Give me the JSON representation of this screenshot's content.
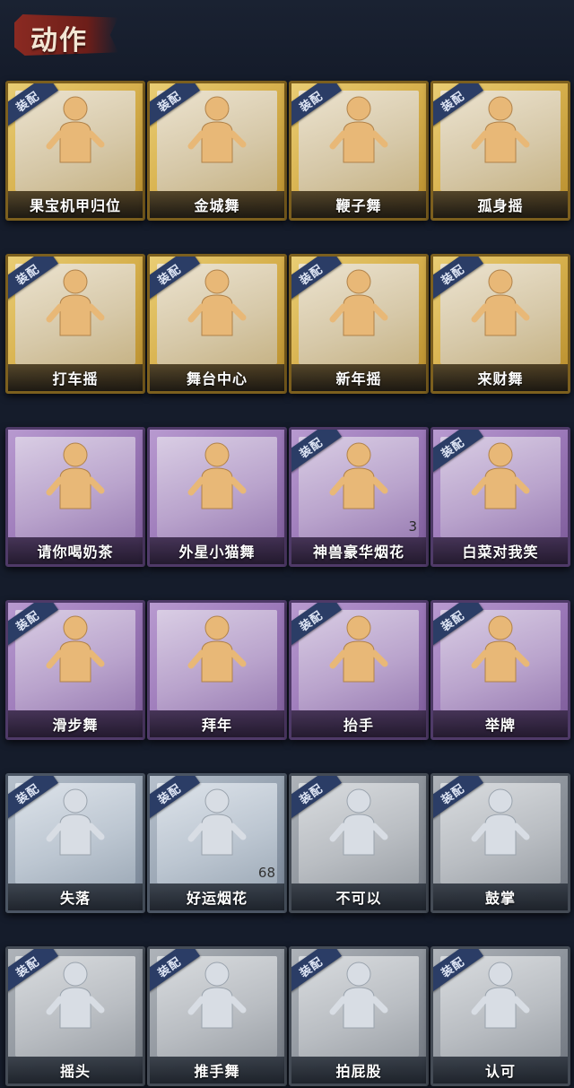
{
  "header": {
    "title": "动作"
  },
  "equip_label": "装配",
  "cards": [
    {
      "label": "果宝机甲归位",
      "tier": "gold",
      "equipped": true,
      "count": ""
    },
    {
      "label": "金城舞",
      "tier": "gold",
      "equipped": true,
      "count": ""
    },
    {
      "label": "鞭子舞",
      "tier": "gold",
      "equipped": true,
      "count": ""
    },
    {
      "label": "孤身摇",
      "tier": "gold",
      "equipped": true,
      "count": ""
    },
    {
      "label": "打车摇",
      "tier": "gold",
      "equipped": true,
      "count": ""
    },
    {
      "label": "舞台中心",
      "tier": "gold",
      "equipped": true,
      "count": ""
    },
    {
      "label": "新年摇",
      "tier": "gold",
      "equipped": true,
      "count": ""
    },
    {
      "label": "来财舞",
      "tier": "gold",
      "equipped": true,
      "count": ""
    },
    {
      "label": "请你喝奶茶",
      "tier": "purple",
      "equipped": false,
      "count": ""
    },
    {
      "label": "外星小猫舞",
      "tier": "purple",
      "equipped": false,
      "count": ""
    },
    {
      "label": "神兽豪华烟花",
      "tier": "purple",
      "equipped": true,
      "count": "3"
    },
    {
      "label": "白菜对我笑",
      "tier": "purple",
      "equipped": true,
      "count": ""
    },
    {
      "label": "滑步舞",
      "tier": "purple",
      "equipped": true,
      "count": ""
    },
    {
      "label": "拜年",
      "tier": "purple",
      "equipped": false,
      "count": ""
    },
    {
      "label": "抬手",
      "tier": "purple",
      "equipped": true,
      "count": ""
    },
    {
      "label": "举牌",
      "tier": "purple",
      "equipped": true,
      "count": ""
    },
    {
      "label": "失落",
      "tier": "silver",
      "equipped": true,
      "count": ""
    },
    {
      "label": "好运烟花",
      "tier": "silver",
      "equipped": true,
      "count": "68"
    },
    {
      "label": "不可以",
      "tier": "grey",
      "equipped": true,
      "count": ""
    },
    {
      "label": "鼓掌",
      "tier": "grey",
      "equipped": true,
      "count": ""
    },
    {
      "label": "摇头",
      "tier": "grey",
      "equipped": true,
      "count": ""
    },
    {
      "label": "推手舞",
      "tier": "grey",
      "equipped": true,
      "count": ""
    },
    {
      "label": "拍屁股",
      "tier": "grey",
      "equipped": true,
      "count": ""
    },
    {
      "label": "认可",
      "tier": "grey",
      "equipped": true,
      "count": ""
    }
  ]
}
